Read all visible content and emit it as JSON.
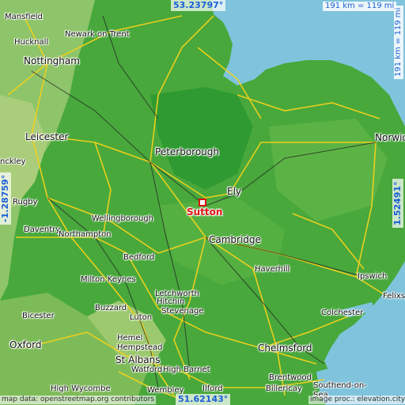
{
  "target": {
    "name": "Sutton"
  },
  "coords": {
    "north": "53.23797°",
    "south": "51.62143°",
    "west": "-1.28759°",
    "east": "1.52491°"
  },
  "scale": {
    "horizontal": "191 km = 119 mi",
    "vertical": "191 km = 119 mi"
  },
  "credits": {
    "left": "map data: openstreetmap.org contributors",
    "right": "image proc.: elevation.city"
  },
  "places": {
    "mansfield": "Mansfield",
    "newark": "Newark on Trent",
    "hucknall": "Hucknall",
    "nottingham": "Nottingham",
    "leicester": "Leicester",
    "peterborough": "Peterborough",
    "norwich": "Norwich",
    "ely": "Ely",
    "hinckley": "nckley",
    "rugby": "Rugby",
    "wellingborough": "Wellingborough",
    "daventry": "Daventry",
    "northampton": "Northampton",
    "cambridge": "Cambridge",
    "bedford": "Bedford",
    "haverhill": "Haverhill",
    "ipswich": "Ipswich",
    "milton_keynes": "Milton Keynes",
    "letchworth": "Letchworth",
    "hitchin": "Hitchin",
    "buzzard": "Buzzard",
    "luton": "Luton",
    "stevenage": "Stevenage",
    "felixstowe": "Felixs",
    "colchester": "Colchester",
    "oxford": "Oxford",
    "hemel": "Hemel\nHempstead",
    "chelmsford": "Chelmsford",
    "st_albans": "St Albans",
    "watford": "Watford",
    "high_barnet": "High Barnet",
    "brentwood": "Brentwood",
    "high_wycombe": "High Wycombe",
    "wembley": "Wembley",
    "ilford": "Ilford",
    "billericay": "Billericay",
    "southend": "Southend-on-\nSea",
    "bicester": "Bicester"
  },
  "colors": {
    "sea": "#7fc4dc",
    "lowland": "#3fa83a",
    "upland": "#6fbd55",
    "road": "#f2d21b",
    "rail": "#222222"
  }
}
